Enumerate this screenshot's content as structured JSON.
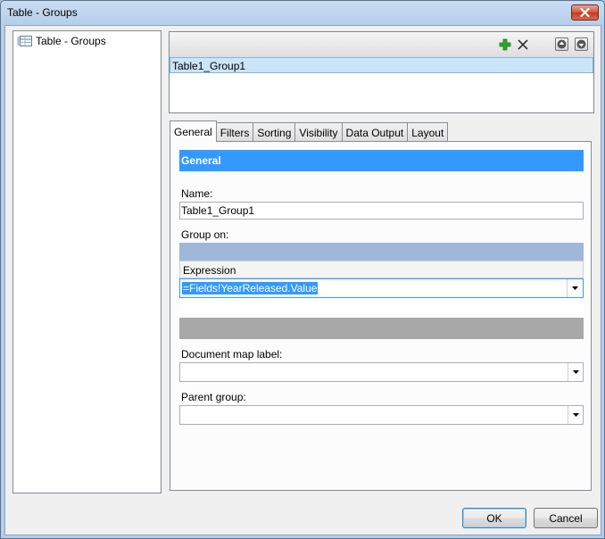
{
  "window": {
    "title": "Table - Groups"
  },
  "tree": {
    "root_label": "Table - Groups"
  },
  "groups": {
    "items": [
      "Table1_Group1"
    ]
  },
  "tabs": [
    {
      "label": "General",
      "active": true
    },
    {
      "label": "Filters",
      "active": false
    },
    {
      "label": "Sorting",
      "active": false
    },
    {
      "label": "Visibility",
      "active": false
    },
    {
      "label": "Data Output",
      "active": false
    },
    {
      "label": "Layout",
      "active": false
    }
  ],
  "general": {
    "section_title": "General",
    "name_label": "Name:",
    "name_value": "Table1_Group1",
    "group_on_label": "Group on:",
    "group_on_header": "Expression",
    "group_on_value": "=Fields!YearReleased.Value",
    "document_map_label": "Document map label:",
    "document_map_value": "",
    "parent_group_label": "Parent group:",
    "parent_group_value": ""
  },
  "buttons": {
    "ok": "OK",
    "cancel": "Cancel"
  },
  "colors": {
    "selection": "#3399ff",
    "row_highlight": "#cce4f7",
    "add_green": "#2fa52f"
  },
  "icons": [
    "close-icon",
    "table-icon",
    "add-icon",
    "delete-icon",
    "move-up-icon",
    "move-down-icon",
    "dropdown-arrow-icon"
  ]
}
